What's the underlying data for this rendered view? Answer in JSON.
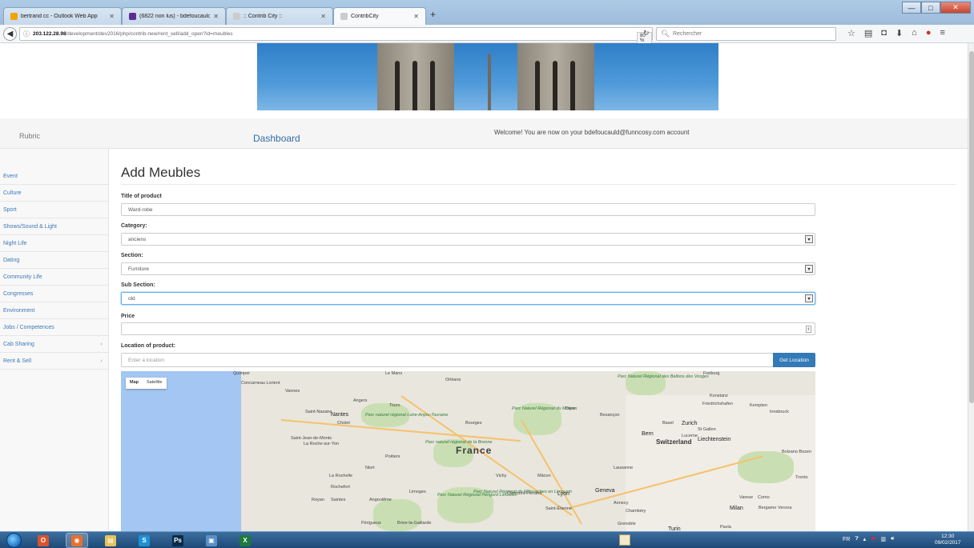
{
  "browser": {
    "tabs": [
      {
        "label": "bertrand cc - Outlook Web App",
        "favicon_color": "#f0a30a"
      },
      {
        "label": "(6822 non lus) - bdefoucauld - Y...",
        "favicon_color": "#5c2d91"
      },
      {
        "label": ":: Contrib City ::",
        "favicon_color": "#cccccc"
      },
      {
        "label": "ContribCity",
        "favicon_color": "#cccccc"
      }
    ],
    "new_tab": "+",
    "url_host": "203.122.28.98",
    "url_path": "/development/dev2016/php/contrib-new/rent_sell/add_open?id=meubles",
    "zoom": "80 %",
    "search_placeholder": "Rechercher"
  },
  "header": {
    "rubric": "Rubric",
    "dashboard": "Dashboard",
    "welcome": "Welcome! You are now on your bdefoucauld@funncosy.com account"
  },
  "sidebar": {
    "items": [
      {
        "label": "Event"
      },
      {
        "label": "Culture"
      },
      {
        "label": "Sport"
      },
      {
        "label": "Shows/Sound & Light"
      },
      {
        "label": "Night Life"
      },
      {
        "label": "Dating"
      },
      {
        "label": "Community Life"
      },
      {
        "label": "Congresses"
      },
      {
        "label": "Environment"
      },
      {
        "label": "Jobs / Competences"
      },
      {
        "label": "Cab Sharing",
        "caret": "‹"
      },
      {
        "label": "Rent & Sell",
        "caret": "‹"
      }
    ]
  },
  "form": {
    "title": "Add Meubles",
    "title_label": "Title of product",
    "title_value": "Ward-robe",
    "category_label": "Category:",
    "category_value": "anciens",
    "section_label": "Section:",
    "section_value": "Furniture",
    "subsection_label": "Sub Section:",
    "subsection_value": "old",
    "price_label": "Price",
    "price_value": "",
    "location_label": "Location of product:",
    "location_placeholder": "Enter a location",
    "get_location": "Get Location"
  },
  "map": {
    "toggle_map": "Map",
    "toggle_satellite": "Satellite",
    "country": "France",
    "country2": "Switzerland",
    "labels": [
      {
        "text": "Quimper",
        "cls": ""
      },
      {
        "text": "Concarneau Lorient",
        "cls": ""
      },
      {
        "text": "Vannes",
        "cls": ""
      },
      {
        "text": "Le Mans",
        "cls": ""
      },
      {
        "text": "Orléans",
        "cls": ""
      },
      {
        "text": "Angers",
        "cls": ""
      },
      {
        "text": "Tours",
        "cls": ""
      },
      {
        "text": "Saint-Nazaire",
        "cls": ""
      },
      {
        "text": "Nantes",
        "cls": "city"
      },
      {
        "text": "Parc naturel régional Loire-Anjou-Touraine",
        "cls": "park"
      },
      {
        "text": "Cholet",
        "cls": ""
      },
      {
        "text": "Bourges",
        "cls": ""
      },
      {
        "text": "Parc Naturel Régional du Morvan",
        "cls": "park"
      },
      {
        "text": "Dijon",
        "cls": ""
      },
      {
        "text": "Besançon",
        "cls": ""
      },
      {
        "text": "Saint-Jean-de-Monts",
        "cls": ""
      },
      {
        "text": "La Roche-sur-Yon",
        "cls": ""
      },
      {
        "text": "Poitiers",
        "cls": ""
      },
      {
        "text": "Parc naturel régional de la Brenne",
        "cls": "park"
      },
      {
        "text": "Niort",
        "cls": ""
      },
      {
        "text": "La Rochelle",
        "cls": ""
      },
      {
        "text": "Rochefort",
        "cls": ""
      },
      {
        "text": "Limoges",
        "cls": ""
      },
      {
        "text": "Royan",
        "cls": ""
      },
      {
        "text": "Saintes",
        "cls": ""
      },
      {
        "text": "Angoulême",
        "cls": ""
      },
      {
        "text": "Parc Naturel Régional Périgord Limousin",
        "cls": "park"
      },
      {
        "text": "Parc Naturel Régional de Millevaches en Limousin",
        "cls": "park"
      },
      {
        "text": "Clermont-Ferrand",
        "cls": ""
      },
      {
        "text": "Vichy",
        "cls": ""
      },
      {
        "text": "Mâcon",
        "cls": ""
      },
      {
        "text": "Lyon",
        "cls": "city"
      },
      {
        "text": "Saint-Étienne",
        "cls": ""
      },
      {
        "text": "Périgueux",
        "cls": ""
      },
      {
        "text": "Brive-la-Gaillarde",
        "cls": ""
      },
      {
        "text": "Grenoble",
        "cls": ""
      },
      {
        "text": "Chambéry",
        "cls": ""
      },
      {
        "text": "Annecy",
        "cls": ""
      },
      {
        "text": "Geneva",
        "cls": "city"
      },
      {
        "text": "Lausanne",
        "cls": ""
      },
      {
        "text": "Bern",
        "cls": "city"
      },
      {
        "text": "Basel",
        "cls": ""
      },
      {
        "text": "Zurich",
        "cls": "city"
      },
      {
        "text": "Lucerne",
        "cls": ""
      },
      {
        "text": "St Gallen",
        "cls": ""
      },
      {
        "text": "Liechtenstein",
        "cls": "city"
      },
      {
        "text": "Konstanz",
        "cls": ""
      },
      {
        "text": "Friedrichshafen",
        "cls": ""
      },
      {
        "text": "Kempten",
        "cls": ""
      },
      {
        "text": "Innsbruck",
        "cls": ""
      },
      {
        "text": "Freiburg",
        "cls": ""
      },
      {
        "text": "Bolzano Bozen",
        "cls": ""
      },
      {
        "text": "Trento",
        "cls": ""
      },
      {
        "text": "Varese",
        "cls": ""
      },
      {
        "text": "Como",
        "cls": ""
      },
      {
        "text": "Bergamo",
        "cls": ""
      },
      {
        "text": "Milan",
        "cls": "city"
      },
      {
        "text": "Verona",
        "cls": ""
      },
      {
        "text": "Turin",
        "cls": "city"
      },
      {
        "text": "Pavia",
        "cls": ""
      },
      {
        "text": "Parc Naturel Régional des Ballons des Vosges",
        "cls": "park"
      }
    ]
  },
  "taskbar": {
    "apps": [
      {
        "label": "O",
        "color": "#d9532c"
      },
      {
        "label": "◉",
        "color": "#e8702a"
      },
      {
        "label": "▤",
        "color": "#e6c35c"
      },
      {
        "label": "S",
        "color": "#1e90d6"
      },
      {
        "label": "Ps",
        "color": "#0b2a4a"
      },
      {
        "label": "▣",
        "color": "#5b8fc9"
      },
      {
        "label": "X",
        "color": "#1d7a3c"
      }
    ],
    "lang": "FR",
    "time": "12:30",
    "date": "09/02/2017"
  }
}
